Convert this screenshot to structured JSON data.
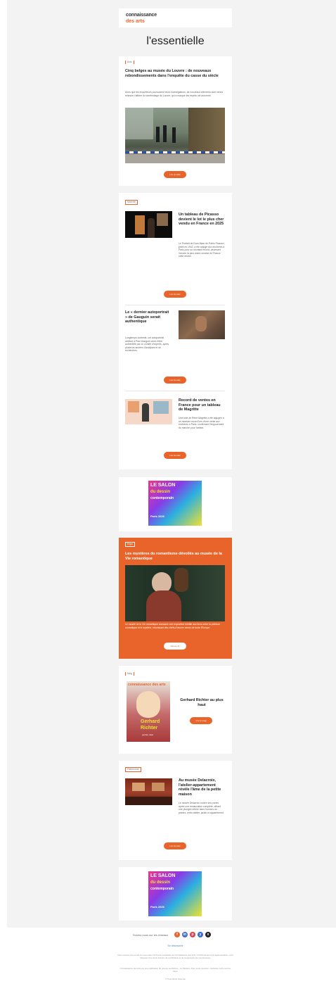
{
  "header": {
    "logo_line1": "connaissance",
    "logo_line2": "des arts",
    "headline": "l'essentielle"
  },
  "article1": {
    "tag": "Actu",
    "title": "Cinq belges au musée du Louvre : de nouveaux rebondissements dans l'enquête du casse du siècle",
    "text": "Alors que les enquêteurs poursuivent leurs investigations, de nouveaux éléments sont venus relancer l'affaire du cambriolage du Louvre, qui a marqué les esprits cet automne.",
    "button": "Lire la suite"
  },
  "section2": {
    "tag": "Marché",
    "items": [
      {
        "title": "Un tableau de Picasso devient le lot le plus cher vendu en France en 2025",
        "text": "Le Portrait de Dora Maar de Pablo Picasso, peint en 1942, a été adjugé aux enchères à Paris pour un montant record, devenant l'œuvre la plus chère vendue en France cette année.",
        "button": "Lire la suite"
      },
      {
        "title": "Le « dernier autoportrait » de Gauguin serait authentique",
        "text": "Longtemps contesté, cet autoportrait attribué à Paul Gauguin vient d'être authentifié par un comité d'experts, après plusieurs années d'analyses et de recherches.",
        "button": "Lire la suite"
      },
      {
        "title": "Record de ventes en France pour un tableau de Magritte",
        "text": "Une toile de René Magritte a été adjugée à un montant record lors d'une vente aux enchères à Paris, confirmant l'engouement du marché pour l'artiste.",
        "button": "Lire la suite"
      }
    ]
  },
  "ad1": {
    "line1": "LE SALON",
    "line2": "du dessin",
    "line3": "contemporain",
    "line4": "Paris 2026"
  },
  "feature": {
    "tag": "Expo",
    "title": "Les mystères du romantisme dévoilés au musée de la Vie romantique",
    "text": "Le musée de la Vie romantique consacre une exposition inédite aux liens entre la peinture romantique et le mystère, réunissant des chefs-d'œuvre venus de toute l'Europe.",
    "button": "Découvrir"
  },
  "magazine": {
    "tag": "Mag",
    "cover_brand": "connaissance des arts",
    "cover_title1": "Gerhard",
    "cover_title2": "Richter",
    "cover_sub": "peintre total",
    "title": "Gerhard Richter au plus haut",
    "button": "Lire le mag"
  },
  "section3": {
    "tag": "Patrimoine",
    "title": "Au musée Delacroix, l'atelier-appartement révèle l'âme de la petite maison",
    "text": "Le musée Delacroix rouvre ses portes après une restauration complète, offrant une plongée intime dans l'univers du peintre, entre atelier, jardin et appartement.",
    "button": "Lire la suite"
  },
  "ad2": {
    "line1": "LE SALON",
    "line2": "du dessin",
    "line3": "contemporain",
    "line4": "Paris 2026"
  },
  "footer": {
    "follow_label": "Suivez-nous sur les réseaux",
    "social": [
      "f",
      "in",
      "p",
      "y",
      "x"
    ],
    "link": "Se désinscrire",
    "legal1": "Vous recevez cet e-mail car vous êtes inscrit à la newsletter de Connaissance des Arts. Conformément à la réglementation, vous disposez d'un droit d'accès, de rectification et de suppression de vos données.",
    "legal2": "Connaissance des Arts est une publication du groupe Les Echos - Le Parisien. Pour toute question, contactez notre service client.",
    "legal3": "© Tous droits réservés"
  },
  "colors": {
    "accent": "#e8642a",
    "page_bg": "#f3f3f3",
    "card_bg": "#ffffff"
  }
}
